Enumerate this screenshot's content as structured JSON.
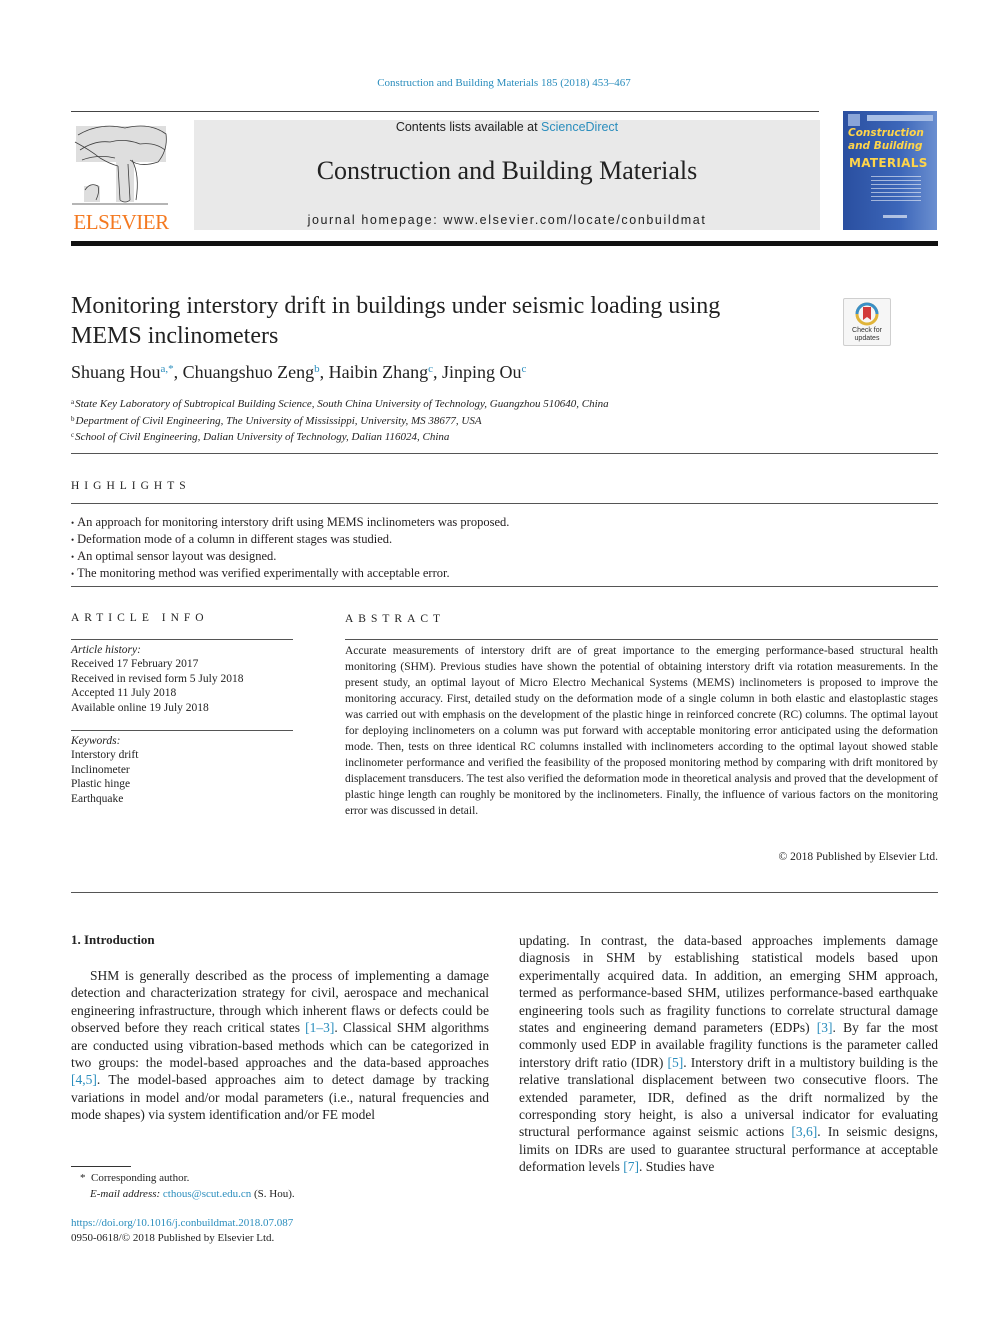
{
  "header": {
    "citation": "Construction and Building Materials 185 (2018) 453–467",
    "contents_prefix": "Contents lists available at ",
    "contents_link": "ScienceDirect",
    "journal_title": "Construction and Building Materials",
    "homepage_prefix": "journal homepage: ",
    "homepage_url": "www.elsevier.com/locate/conbuildmat",
    "publisher_logo_text": "ELSEVIER",
    "cover": {
      "line1": "Construction",
      "line2": "and Building",
      "line3": "MATERIALS"
    }
  },
  "check_updates": {
    "line1": "Check for",
    "line2": "updates"
  },
  "article": {
    "title": "Monitoring interstory drift in buildings under seismic loading using MEMS inclinometers",
    "authors": [
      {
        "name": "Shuang Hou",
        "sup": "a,*"
      },
      {
        "name": "Chuangshuo Zeng",
        "sup": "b"
      },
      {
        "name": "Haibin Zhang",
        "sup": "c"
      },
      {
        "name": "Jinping Ou",
        "sup": "c"
      }
    ],
    "affiliations": [
      {
        "key": "a",
        "text": "State Key Laboratory of Subtropical Building Science, South China University of Technology, Guangzhou 510640, China"
      },
      {
        "key": "b",
        "text": "Department of Civil Engineering, The University of Mississippi, University, MS 38677, USA"
      },
      {
        "key": "c",
        "text": "School of Civil Engineering, Dalian University of Technology, Dalian 116024, China"
      }
    ]
  },
  "highlights": {
    "heading": "HIGHLIGHTS",
    "items": [
      "An approach for monitoring interstory drift using MEMS inclinometers was proposed.",
      "Deformation mode of a column in different stages was studied.",
      "An optimal sensor layout was designed.",
      "The monitoring method was verified experimentally with acceptable error."
    ]
  },
  "article_info": {
    "heading": "ARTICLE INFO",
    "history_label": "Article history:",
    "history": [
      "Received 17 February 2017",
      "Received in revised form 5 July 2018",
      "Accepted 11 July 2018",
      "Available online 19 July 2018"
    ],
    "keywords_label": "Keywords:",
    "keywords": [
      "Interstory drift",
      "Inclinometer",
      "Plastic hinge",
      "Earthquake"
    ]
  },
  "abstract": {
    "heading": "ABSTRACT",
    "text": "Accurate measurements of interstory drift are of great importance to the emerging performance-based structural health monitoring (SHM). Previous studies have shown the potential of obtaining interstory drift via rotation measurements. In the present study, an optimal layout of Micro Electro Mechanical Systems (MEMS) inclinometers is proposed to improve the monitoring accuracy. First, detailed study on the deformation mode of a single column in both elastic and elastoplastic stages was carried out with emphasis on the development of the plastic hinge in reinforced concrete (RC) columns. The optimal layout for deploying inclinometers on a column was put forward with acceptable monitoring error anticipated using the deformation mode. Then, tests on three identical RC columns installed with inclinometers according to the optimal layout showed stable inclinometer performance and verified the feasibility of the proposed monitoring method by comparing with drift monitored by displacement transducers. The test also verified the deformation mode in theoretical analysis and proved that the development of plastic hinge length can roughly be monitored by the inclinometers. Finally, the influence of various factors on the monitoring error was discussed in detail.",
    "copyright": "© 2018 Published by Elsevier Ltd."
  },
  "introduction": {
    "heading": "1. Introduction",
    "left": {
      "s1": "SHM is generally described as the process of implementing a damage detection and characterization strategy for civil, aerospace and mechanical engineering infrastructure, through which inherent flaws or defects could be observed before they reach critical states ",
      "r1": "[1–3]",
      "s2": ". Classical SHM algorithms are conducted using vibration-based methods which can be categorized in two groups: the model-based approaches and the data-based approaches ",
      "r2": "[4,5]",
      "s3": ". The model-based approaches aim to detect damage by tracking variations in model and/or modal parameters (i.e., natural frequencies and mode shapes) via system identification and/or FE model"
    },
    "right": {
      "s1": "updating. In contrast, the data-based approaches implements damage diagnosis in SHM by establishing statistical models based upon experimentally acquired data. In addition, an emerging SHM approach, termed as performance-based SHM, utilizes performance-based earthquake engineering tools such as fragility functions to correlate structural damage states and engineering demand parameters (EDPs) ",
      "r1": "[3]",
      "s2": ". By far the most commonly used EDP in available fragility functions is the parameter called interstory drift ratio (IDR) ",
      "r2": "[5]",
      "s3": ". Interstory drift in a multistory building is the relative translational displacement between two consecutive floors. The extended parameter, IDR, defined as the drift normalized by the corresponding story height, is also a universal indicator for evaluating structural performance against seismic actions ",
      "r3": "[3,6]",
      "s4": ". In seismic designs, limits on IDRs are used to guarantee structural performance at acceptable deformation levels ",
      "r4": "[7]",
      "s5": ". Studies have"
    }
  },
  "footnote": {
    "marker": "*",
    "corresponding": "Corresponding author.",
    "email_label": "E-mail address:",
    "email": "cthous@scut.edu.cn",
    "email_suffix": "(S. Hou)."
  },
  "doi": {
    "url": "https://doi.org/10.1016/j.conbuildmat.2018.07.087",
    "issn_line": "0950-0618/© 2018 Published by Elsevier Ltd."
  },
  "colors": {
    "link": "#2a8dbd",
    "elsevier_orange": "#f47920",
    "banner_bg": "#e9e9e9",
    "cover_blue": "#2a4fa0",
    "cover_yellow": "#ffd54a"
  }
}
